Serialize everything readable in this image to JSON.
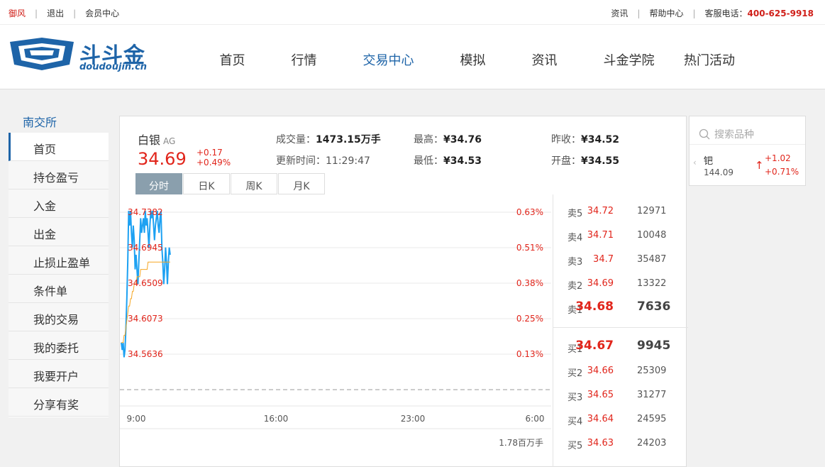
{
  "topbar": {
    "user": "御风",
    "logout": "退出",
    "member_center": "会员中心",
    "news": "资讯",
    "help_center": "帮助中心",
    "phone_label": "客服电话：",
    "phone": "400-625-9918"
  },
  "logo": {
    "name": "斗斗金",
    "domain": "doudoujin.cn"
  },
  "nav": [
    "首页",
    "行情",
    "交易中心",
    "模拟",
    "资讯",
    "斗金学院",
    "热门活动"
  ],
  "nav_active": "交易中心",
  "sidebar": {
    "header": "南交所",
    "items": [
      "首页",
      "持仓盈亏",
      "入金",
      "出金",
      "止损止盈单",
      "条件单",
      "我的交易",
      "我的委托",
      "我要开户",
      "分享有奖"
    ],
    "active": "首页"
  },
  "quote": {
    "name": "白银",
    "code": "AG",
    "price": "34.69",
    "change": "+0.17",
    "change_pct": "+0.49%",
    "volume_label": "成交量：",
    "volume": "1473.15万手",
    "time_label": "更新时间：",
    "time": "11:29:47",
    "high_label": "最高：",
    "high": "¥34.76",
    "low_label": "最低：",
    "low": "¥34.53",
    "prev_close_label": "昨收：",
    "prev_close": "¥34.52",
    "open_label": "开盘：",
    "open": "¥34.55"
  },
  "tabs": [
    "分时",
    "日K",
    "周K",
    "月K"
  ],
  "tab_active": "分时",
  "chart_data": {
    "type": "line",
    "x_ticks": [
      "9:00",
      "16:00",
      "23:00",
      "6:00"
    ],
    "y_labels": [
      "34.7382",
      "34.6945",
      "34.6509",
      "34.6073",
      "34.5636"
    ],
    "pct_labels": [
      "0.63%",
      "0.51%",
      "0.38%",
      "0.25%",
      "0.13%"
    ],
    "ylim": [
      34.52,
      34.7382
    ],
    "volume_label": "1.78百万手",
    "series": [
      {
        "values": [
          34.56,
          34.55,
          34.56,
          34.54,
          34.55,
          34.58,
          34.62,
          34.67,
          34.74,
          34.72,
          34.74,
          34.71,
          34.69,
          34.72,
          34.7,
          34.66,
          34.68,
          34.66,
          34.64,
          34.67,
          34.7,
          34.73,
          34.71,
          34.72,
          34.73,
          34.71,
          34.74,
          34.72,
          34.73,
          34.71,
          34.69,
          34.72,
          34.74,
          34.73,
          34.74,
          34.72,
          34.7,
          34.72,
          34.73,
          34.74,
          34.72,
          34.71,
          34.73,
          34.74,
          34.69,
          34.67,
          34.64,
          34.66,
          34.69,
          34.67,
          34.64,
          34.67,
          34.69,
          34.68
        ]
      },
      {
        "values": [
          34.56,
          34.56,
          34.56,
          34.57,
          34.57,
          34.58,
          34.59,
          34.6,
          34.61,
          34.61,
          34.62,
          34.62,
          34.63,
          34.63,
          34.64,
          34.64,
          34.64,
          34.65,
          34.65,
          34.65,
          34.65,
          34.66,
          34.66,
          34.66,
          34.66,
          34.66,
          34.66,
          34.66,
          34.66,
          34.67,
          34.67,
          34.67,
          34.67,
          34.67,
          34.67,
          34.67,
          34.67,
          34.67,
          34.67,
          34.67,
          34.67,
          34.67,
          34.67,
          34.67,
          34.67,
          34.67,
          34.67,
          34.67,
          34.67,
          34.67,
          34.67,
          34.67,
          34.67,
          34.67
        ]
      }
    ],
    "colors": {
      "price": "#1da1f2",
      "avg": "#f5a623",
      "label": "#e1251b"
    }
  },
  "orderbook": {
    "asks": [
      {
        "label": "卖5",
        "price": "34.72",
        "vol": "12971"
      },
      {
        "label": "卖4",
        "price": "34.71",
        "vol": "10048"
      },
      {
        "label": "卖3",
        "price": "34.7",
        "vol": "35487"
      },
      {
        "label": "卖2",
        "price": "34.69",
        "vol": "13322"
      },
      {
        "label": "卖1",
        "price": "34.68",
        "vol": "7636"
      }
    ],
    "bids": [
      {
        "label": "买1",
        "price": "34.67",
        "vol": "9945"
      },
      {
        "label": "买2",
        "price": "34.66",
        "vol": "25309"
      },
      {
        "label": "买3",
        "price": "34.65",
        "vol": "31277"
      },
      {
        "label": "买4",
        "price": "34.64",
        "vol": "24595"
      },
      {
        "label": "买5",
        "price": "34.63",
        "vol": "24203"
      }
    ]
  },
  "watch": {
    "placeholder": "搜索品种",
    "item": {
      "name": "钯",
      "price": "144.09",
      "change": "+1.02",
      "pct": "+0.71%"
    }
  }
}
